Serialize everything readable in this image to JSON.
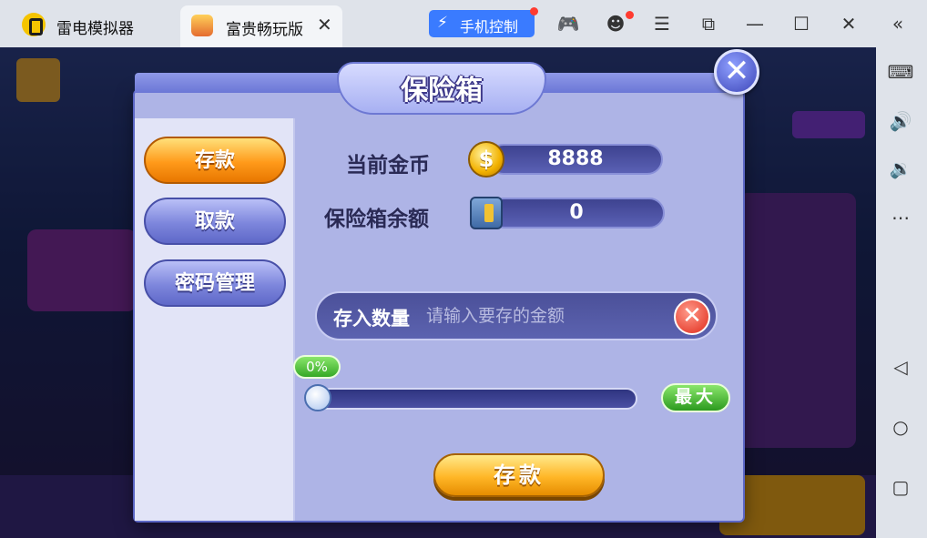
{
  "titlebar": {
    "app_name": "雷电模拟器",
    "tab_label": "富贵畅玩版",
    "phone_control_label": "手机控制"
  },
  "dialog": {
    "title": "保险箱",
    "menu": [
      {
        "label": "存款",
        "active": true
      },
      {
        "label": "取款",
        "active": false
      },
      {
        "label": "密码管理",
        "active": false
      }
    ],
    "current_coins_label": "当前金币",
    "current_coins_value": "8888",
    "safe_balance_label": "保险箱余额",
    "safe_balance_value": "0",
    "input_label": "存入数量",
    "input_placeholder": "请输入要存的金额",
    "slider_percent": "0%",
    "slider_value": 0,
    "max_label": "最大",
    "deposit_button": "存款"
  },
  "colors": {
    "accent_orange": "#ff9a1a",
    "menu_blue": "#7d86dc",
    "dialog_bg": "#aeb4e6",
    "green": "#35a826"
  }
}
